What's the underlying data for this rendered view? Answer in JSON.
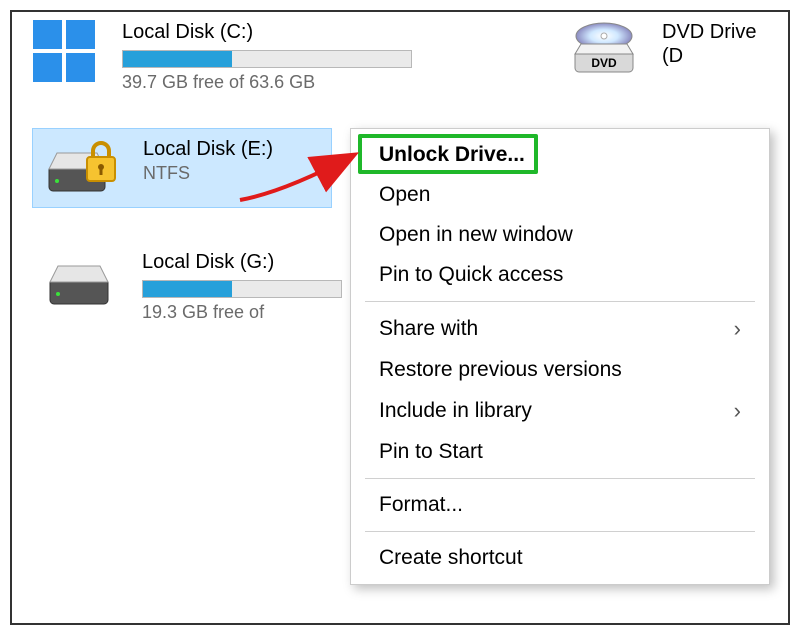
{
  "drives": {
    "c": {
      "title": "Local Disk (C:)",
      "free_text": "39.7 GB free of 63.6 GB",
      "fill_pct": 38
    },
    "dvd": {
      "title": "DVD Drive (D"
    },
    "e": {
      "title": "Local Disk (E:)",
      "sub": "NTFS"
    },
    "g": {
      "title": "Local Disk (G:)",
      "free_text": "19.3 GB free of",
      "fill_pct": 45
    }
  },
  "context_menu": {
    "items": [
      {
        "label": "Unlock Drive...",
        "bold": true,
        "highlighted": true
      },
      {
        "label": "Open"
      },
      {
        "label": "Open in new window"
      },
      {
        "label": "Pin to Quick access"
      },
      {
        "sep": true
      },
      {
        "label": "Share with",
        "submenu": true
      },
      {
        "label": "Restore previous versions"
      },
      {
        "label": "Include in library",
        "submenu": true
      },
      {
        "label": "Pin to Start"
      },
      {
        "sep": true
      },
      {
        "label": "Format..."
      },
      {
        "sep": true
      },
      {
        "label": "Create shortcut"
      }
    ]
  }
}
